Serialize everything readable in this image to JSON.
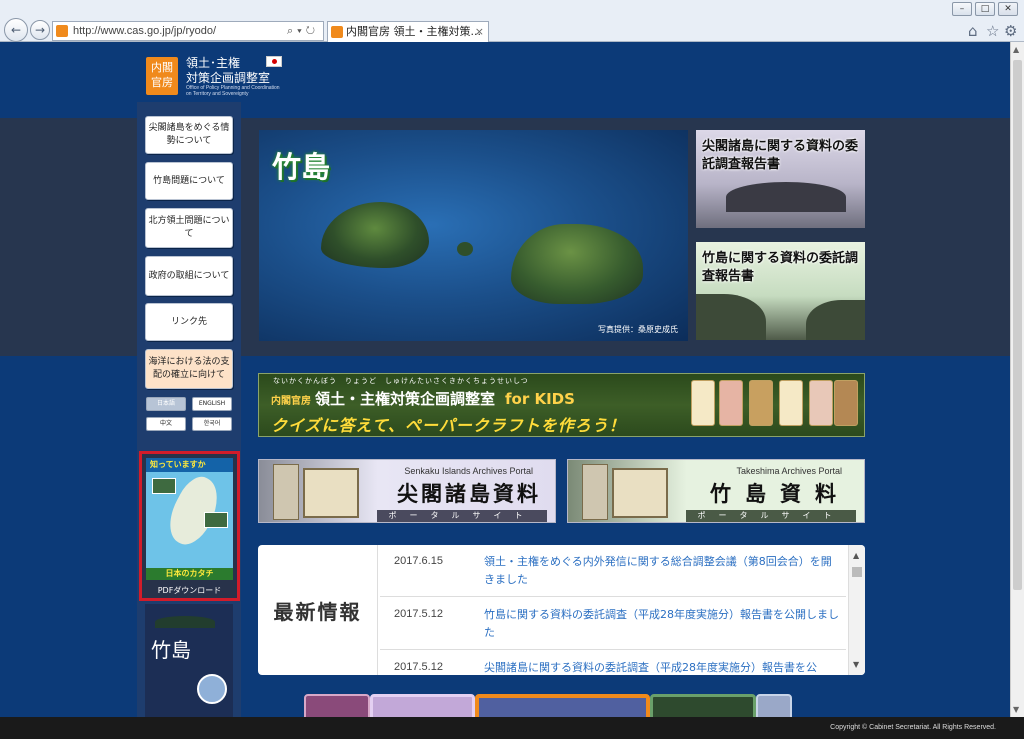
{
  "browser": {
    "url": "http://www.cas.go.jp/jp/ryodo/",
    "tab_title": "内閣官房 領土・主権対策...",
    "tab_close": "×",
    "back": "←",
    "forward": "→",
    "addr_tools": "⌕▾↻"
  },
  "header": {
    "logo_text": "内閣官房",
    "title_line1": "領土･主権",
    "title_line2": "対策企画調整室",
    "subtitle": "Office of Policy Planning and Coordination on Territory and Sovereignty"
  },
  "sidebar": {
    "items": [
      {
        "label": "尖閣諸島をめぐる情勢について"
      },
      {
        "label": "竹島問題について"
      },
      {
        "label": "北方領土問題について"
      },
      {
        "label": "政府の取組について"
      },
      {
        "label": "リンク先"
      },
      {
        "label": "海洋における法の支配の確立に向けて"
      }
    ],
    "languages": [
      "日本語",
      "ENGLISH",
      "中文",
      "한국어"
    ],
    "pdf_card": {
      "header": "知っていますか",
      "footer": "日本のカタチ",
      "label": "PDFダウンロード"
    },
    "poster_title": "竹島"
  },
  "hero": {
    "title": "竹島",
    "credit": "写真提供：桑原史成氏"
  },
  "reports": [
    {
      "title": "尖閣諸島に関する資料の委託調査報告書"
    },
    {
      "title": "竹島に関する資料の委託調査報告書"
    }
  ],
  "kids_banner": {
    "ruby": "ないかくかんぼう　りょうど　しゅけんたいさくきかくちょうせいしつ",
    "org_small": "内閣官房",
    "org": "領土・主権対策企画調整室",
    "for_kids": "for KIDS",
    "subtitle": "クイズに答えて、ペーパークラフトを作ろう！"
  },
  "portals": [
    {
      "en": "Senkaku Islands Archives Portal",
      "jp": "尖閣諸島資料",
      "kana": "ポータルサイト"
    },
    {
      "en": "Takeshima Archives Portal",
      "jp": "竹島資料",
      "kana": "ポータルサイト"
    }
  ],
  "news": {
    "label": "最新情報",
    "items": [
      {
        "date": "2017.6.15",
        "text": "領土・主権をめぐる内外発信に関する総合調整会議（第8回会合）を開きました"
      },
      {
        "date": "2017.5.12",
        "text": "竹島に関する資料の委託調査（平成28年度実施分）報告書を公開しました"
      },
      {
        "date": "2017.5.12",
        "text": "尖閣諸島に関する資料の委託調査（平成28年度実施分）報告書を公"
      }
    ]
  },
  "footer": {
    "copyright": "Copyright © Cabinet Secretariat. All Rights Reserved."
  }
}
